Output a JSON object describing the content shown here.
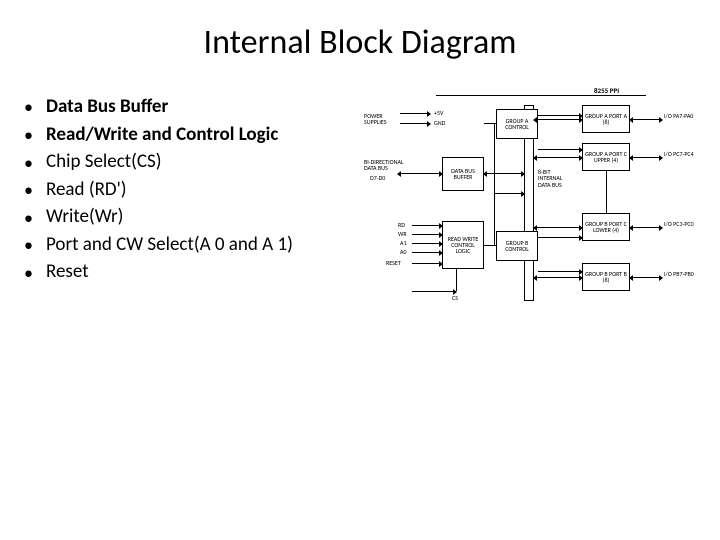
{
  "title": "Internal Block Diagram",
  "bullets": [
    {
      "text": "Data Bus Buffer",
      "bold": true
    },
    {
      "text": "Read/Write and Control Logic",
      "bold": true
    },
    {
      "text": "Chip Select(CS)",
      "bold": false
    },
    {
      "text": "Read (RD')",
      "bold": false
    },
    {
      "text": "Write(Wr)",
      "bold": false
    },
    {
      "text": "Port and CW Select(A 0 and A 1)",
      "bold": false
    },
    {
      "text": "Reset",
      "bold": false
    }
  ],
  "diagram": {
    "chip_label": "8255 PPI",
    "power": {
      "label": "POWER SUPPLIES",
      "pins": [
        "+5V",
        "GND"
      ]
    },
    "data_bus_external": {
      "label": "BI-DIRECTIONAL DATA BUS",
      "pins": "D7-D0"
    },
    "blocks": {
      "data_bus_buffer": "DATA BUS BUFFER",
      "rw_logic": "READ WRITE CONTROL LOGIC",
      "group_a_ctrl": "GROUP A CONTROL",
      "group_b_ctrl": "GROUP B CONTROL",
      "port_a": "GROUP A PORT A (8)",
      "port_c_upper": "GROUP A PORT C UPPER (4)",
      "port_c_lower": "GROUP B PORT C LOWER (4)",
      "port_b": "GROUP B PORT B (8)"
    },
    "internal_bus_label": "8-BIT INTERNAL DATA BUS",
    "control_pins": [
      "RD",
      "WR",
      "A1",
      "A0",
      "RESET"
    ],
    "cs_pin": "CS",
    "io_labels": {
      "pa": "I/O PA7-PA0",
      "pc_upper": "I/O PC7-PC4",
      "pc_lower": "I/O PC3-PC0",
      "pb": "I/O PB7-PB0"
    }
  }
}
